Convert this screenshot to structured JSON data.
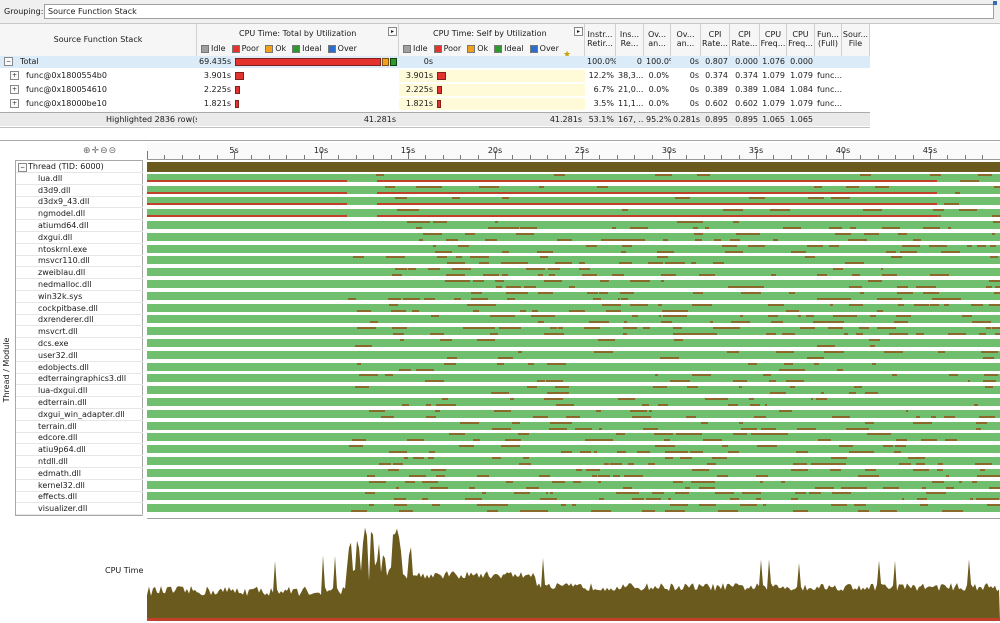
{
  "grouping": {
    "label": "Grouping:",
    "value": "Source Function Stack"
  },
  "grid": {
    "headers": {
      "stack": "Source Function Stack",
      "total_title": "CPU Time: Total by Utilization",
      "self_title": "CPU Time: Self by Utilization",
      "legend": [
        "Idle",
        "Poor",
        "Ok",
        "Ideal",
        "Over"
      ],
      "instr": "Instr... Retir...",
      "ins_re": "Ins... Re...",
      "ov1": "Ov... an...",
      "ov2": "Ov... an...",
      "cpi1": "CPI Rate...",
      "cpi2": "CPI Rate...",
      "freq1": "CPU Freq...",
      "freq2": "CPU Freq...",
      "fun": "Fun... (Full)",
      "src": "Sour... File"
    },
    "legend_colors": {
      "Idle": "#a0a0a0",
      "Poor": "#e4332c",
      "Ok": "#f2a11c",
      "Ideal": "#2e9a2e",
      "Over": "#2a6fd0"
    },
    "rows": [
      {
        "name": "Total",
        "total": "69.435s",
        "self": "0s",
        "instr": "100.0%",
        "ins_re": "0",
        "ov1": "100.0%",
        "ov2": "0s",
        "cpi1": "0.807",
        "cpi2": "0.000",
        "freq1": "1.076",
        "freq2": "0.000",
        "fun": "",
        "src": "",
        "total_fill": 1.0,
        "self_fill": 0
      },
      {
        "name": "func@0x1800554b0",
        "total": "3.901s",
        "self": "3.901s",
        "instr": "12.2%",
        "ins_re": "38,3...",
        "ov1": "0.0%",
        "ov2": "0s",
        "cpi1": "0.374",
        "cpi2": "0.374",
        "freq1": "1.079",
        "freq2": "1.079",
        "fun": "func...",
        "src": "",
        "total_fill": 0.06,
        "self_fill": 0.06
      },
      {
        "name": "func@0x180054610",
        "total": "2.225s",
        "self": "2.225s",
        "instr": "6.7%",
        "ins_re": "21,0...",
        "ov1": "0.0%",
        "ov2": "0s",
        "cpi1": "0.389",
        "cpi2": "0.389",
        "freq1": "1.084",
        "freq2": "1.084",
        "fun": "func...",
        "src": "",
        "total_fill": 0.035,
        "self_fill": 0.035
      },
      {
        "name": "func@0x18000be10",
        "total": "1.821s",
        "self": "1.821s",
        "instr": "3.5%",
        "ins_re": "11,1...",
        "ov1": "0.0%",
        "ov2": "0s",
        "cpi1": "0.602",
        "cpi2": "0.602",
        "freq1": "1.079",
        "freq2": "1.079",
        "fun": "func...",
        "src": "",
        "total_fill": 0.03,
        "self_fill": 0.03
      }
    ],
    "summary": {
      "label": "Highlighted 2836 row(s):",
      "total": "41.281s",
      "self": "41.281s",
      "instr": "53.1%",
      "ins_re": "167, ...",
      "ov1": "95.2%",
      "ov2": "0.281s",
      "cpi1": "0.895",
      "cpi2": "0.895",
      "freq1": "1.065",
      "freq2": "1.065"
    }
  },
  "timeline": {
    "axis_ticks": [
      "5s",
      "10s",
      "15s",
      "20s",
      "25s",
      "30s",
      "35s",
      "40s",
      "45s"
    ],
    "side_label": "Thread / Module",
    "thread_header": "Thread (TID: 6000)",
    "modules": [
      "lua.dll",
      "d3d9.dll",
      "d3dx9_43.dll",
      "ngmodel.dll",
      "atiumd64.dll",
      "dxgui.dll",
      "ntoskrnl.exe",
      "msvcr110.dll",
      "zweiblau.dll",
      "nedmalloc.dll",
      "win32k.sys",
      "cockpitbase.dll",
      "dxrenderer.dll",
      "msvcrt.dll",
      "dcs.exe",
      "user32.dll",
      "edobjects.dll",
      "edterraingraphics3.dll",
      "lua-dxgui.dll",
      "edterrain.dll",
      "dxgui_win_adapter.dll",
      "terrain.dll",
      "edcore.dll",
      "atiu9p64.dll",
      "ntdll.dll",
      "edmath.dll",
      "kernel32.dll",
      "effects.dll",
      "visualizer.dll"
    ],
    "cpu_label": "CPU Time",
    "lane_color": "#6fbf6f",
    "cpu_color": "#6b5a1e"
  }
}
